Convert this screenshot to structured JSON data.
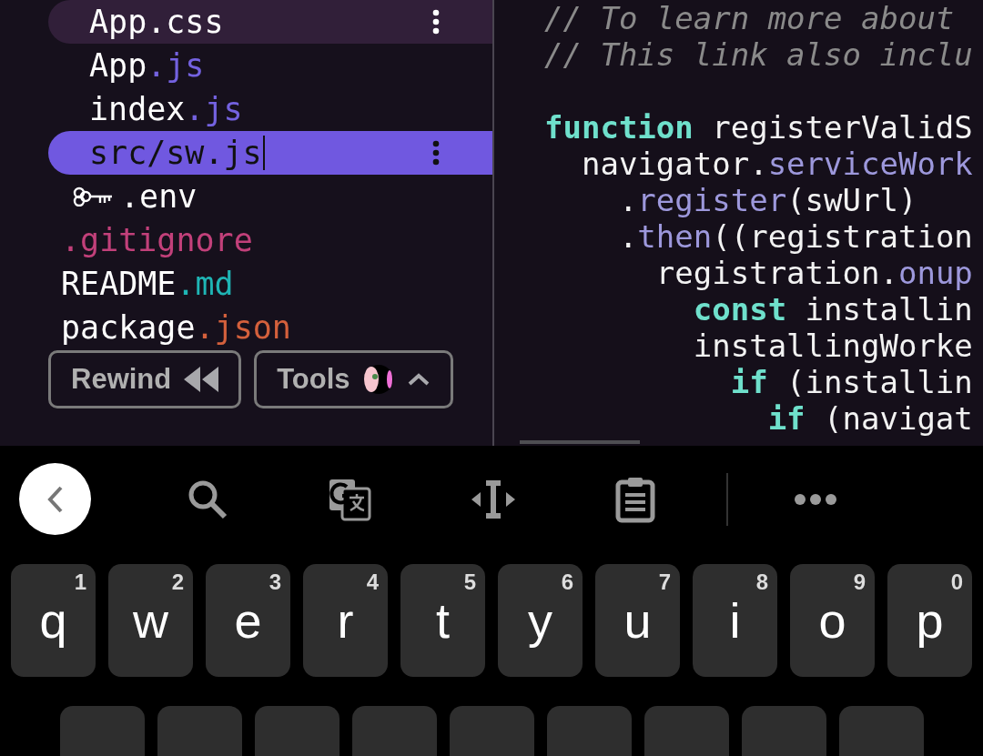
{
  "file_tree": {
    "items": [
      {
        "kind": "child",
        "name": "App.css",
        "highlighted": true,
        "selected": false
      },
      {
        "kind": "child",
        "name": "App",
        "ext": ".js",
        "color": "#7462e0",
        "highlighted": false,
        "selected": false
      },
      {
        "kind": "child",
        "name": "index",
        "ext": ".js",
        "color": "#7462e0",
        "highlighted": false,
        "selected": false
      },
      {
        "kind": "child",
        "name": "src/sw.js",
        "highlighted": false,
        "selected": true
      },
      {
        "kind": "secret",
        "name": ".env",
        "highlighted": false,
        "selected": false
      },
      {
        "kind": "root",
        "ext": ".gitignore",
        "color": "#c2407a",
        "highlighted": false,
        "selected": false
      },
      {
        "kind": "root",
        "name": "README",
        "ext": ".md",
        "color": "#1fb5b5",
        "highlighted": false,
        "selected": false
      },
      {
        "kind": "root",
        "name": "package",
        "ext": ".json",
        "color": "#d4603c",
        "highlighted": false,
        "selected": false
      }
    ]
  },
  "floating_buttons": [
    {
      "label": "Rewind",
      "kind": "rewind"
    },
    {
      "label": "Tools",
      "kind": "tools"
    }
  ],
  "code": {
    "lines": [
      {
        "tokens": [
          {
            "kind": "comment",
            "text": "// To learn more about"
          }
        ]
      },
      {
        "tokens": [
          {
            "kind": "comment",
            "text": "// This link also inclu"
          }
        ]
      },
      {
        "gap_before": true,
        "tokens": [
          {
            "kind": "keyword",
            "text": "function"
          },
          {
            "kind": "plain",
            "text": " registerValidS"
          }
        ]
      },
      {
        "tokens": [
          {
            "kind": "plain",
            "text": "  navigator."
          },
          {
            "kind": "prop",
            "text": "serviceWork"
          }
        ]
      },
      {
        "tokens": [
          {
            "kind": "plain",
            "text": "    ."
          },
          {
            "kind": "prop",
            "text": "register"
          },
          {
            "kind": "plain",
            "text": "(swUrl)"
          }
        ]
      },
      {
        "tokens": [
          {
            "kind": "plain",
            "text": "    ."
          },
          {
            "kind": "prop",
            "text": "then"
          },
          {
            "kind": "plain",
            "text": "((registration"
          }
        ]
      },
      {
        "tokens": [
          {
            "kind": "plain",
            "text": "      registration."
          },
          {
            "kind": "prop",
            "text": "onup"
          }
        ]
      },
      {
        "tokens": [
          {
            "kind": "keyword",
            "text": "        const"
          },
          {
            "kind": "plain",
            "text": " installin"
          }
        ]
      },
      {
        "tokens": [
          {
            "kind": "plain",
            "text": "        installingWorke"
          }
        ]
      },
      {
        "tokens": [
          {
            "kind": "keyword",
            "text": "          if"
          },
          {
            "kind": "plain",
            "text": " (installin"
          }
        ]
      },
      {
        "tokens": [
          {
            "kind": "keyword",
            "text": "            if"
          },
          {
            "kind": "plain",
            "text": " (navigat"
          }
        ]
      }
    ]
  },
  "keyboard": {
    "rows": [
      [
        {
          "letter": "q",
          "hint": "1"
        },
        {
          "letter": "w",
          "hint": "2"
        },
        {
          "letter": "e",
          "hint": "3"
        },
        {
          "letter": "r",
          "hint": "4"
        },
        {
          "letter": "t",
          "hint": "5"
        },
        {
          "letter": "y",
          "hint": "6"
        },
        {
          "letter": "u",
          "hint": "7"
        },
        {
          "letter": "i",
          "hint": "8"
        },
        {
          "letter": "o",
          "hint": "9"
        },
        {
          "letter": "p",
          "hint": "0"
        }
      ]
    ]
  }
}
